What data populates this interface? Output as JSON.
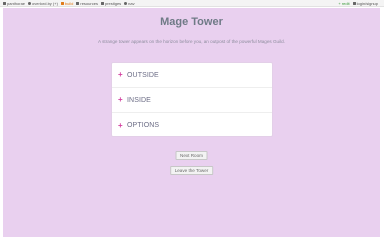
{
  "topbar": {
    "left": [
      {
        "label": "panthorae",
        "icon": "home-icon"
      },
      {
        "label": "overlord.by (+)",
        "icon": "user-icon"
      },
      {
        "label": "build",
        "icon": "build-icon"
      },
      {
        "label": "resources",
        "icon": "box-icon"
      },
      {
        "label": "prestiges",
        "icon": "star-icon"
      },
      {
        "label": "nav",
        "icon": "compass-icon"
      }
    ],
    "right": [
      {
        "label": "+ redit",
        "icon": "plus-icon"
      },
      {
        "label": "login/signup",
        "icon": "login-icon"
      }
    ]
  },
  "page": {
    "title": "Mage Tower",
    "subtitle": "A strange tower appears on the horizon before you, an outpost of the powerful Mages Guild."
  },
  "accordion": [
    {
      "label": "OUTSIDE",
      "icon": "plus-icon"
    },
    {
      "label": "INSIDE",
      "icon": "plus-icon"
    },
    {
      "label": "OPTIONS",
      "icon": "plus-icon"
    }
  ],
  "buttons": {
    "next_room": "Next Room",
    "leave": "Leave the Tower"
  },
  "colors": {
    "background": "#e9d0ef",
    "accent": "#d33fa0",
    "title": "#6f7a86"
  }
}
